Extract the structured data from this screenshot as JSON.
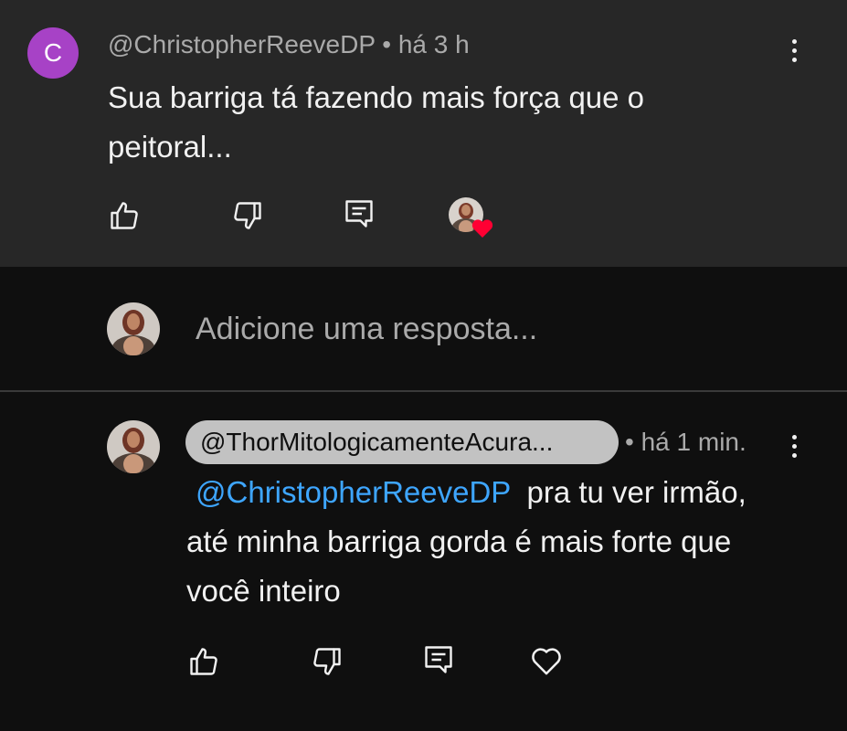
{
  "parent_comment": {
    "avatar_letter": "C",
    "author": "@ChristopherReeveDP",
    "separator": "•",
    "time": "há 3 h",
    "text": "Sua barriga tá fazendo mais força que o peitoral...",
    "heart_color": "#ff0033",
    "avatar_color": "#a742c6"
  },
  "reply_box": {
    "placeholder": "Adicione uma resposta..."
  },
  "reply": {
    "author": "@ThorMitologicamenteAcura...",
    "separator": "•",
    "time": "há 1 min.",
    "mention": "@ChristopherReeveDP",
    "text": "pra tu ver irmão, até minha barriga gorda é mais forte que você inteiro"
  },
  "colors": {
    "top_bg": "#272727",
    "page_bg": "#0f0f0f",
    "link": "#3ea6ff",
    "chip": "#c2c2c2"
  }
}
